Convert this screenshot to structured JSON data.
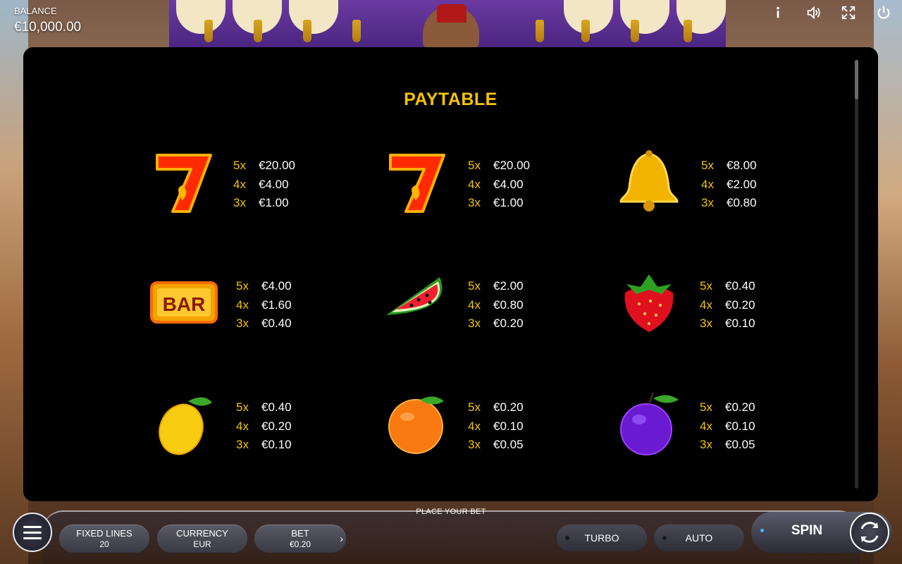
{
  "top_bar": {
    "balance_label": "BALANCE",
    "balance_value": "€10,000.00",
    "icons": [
      "info-icon",
      "sound-icon",
      "fullscreen-icon",
      "power-icon"
    ]
  },
  "paytable": {
    "title": "PAYTABLE",
    "symbols": [
      {
        "name": "red-seven",
        "pays": [
          {
            "mult": "5x",
            "amount": "€20.00"
          },
          {
            "mult": "4x",
            "amount": "€4.00"
          },
          {
            "mult": "3x",
            "amount": "€1.00"
          }
        ]
      },
      {
        "name": "red-seven",
        "pays": [
          {
            "mult": "5x",
            "amount": "€20.00"
          },
          {
            "mult": "4x",
            "amount": "€4.00"
          },
          {
            "mult": "3x",
            "amount": "€1.00"
          }
        ]
      },
      {
        "name": "bell",
        "pays": [
          {
            "mult": "5x",
            "amount": "€8.00"
          },
          {
            "mult": "4x",
            "amount": "€2.00"
          },
          {
            "mult": "3x",
            "amount": "€0.80"
          }
        ]
      },
      {
        "name": "bar",
        "label": "BAR",
        "pays": [
          {
            "mult": "5x",
            "amount": "€4.00"
          },
          {
            "mult": "4x",
            "amount": "€1.60"
          },
          {
            "mult": "3x",
            "amount": "€0.40"
          }
        ]
      },
      {
        "name": "watermelon",
        "pays": [
          {
            "mult": "5x",
            "amount": "€2.00"
          },
          {
            "mult": "4x",
            "amount": "€0.80"
          },
          {
            "mult": "3x",
            "amount": "€0.20"
          }
        ]
      },
      {
        "name": "strawberry",
        "pays": [
          {
            "mult": "5x",
            "amount": "€0.40"
          },
          {
            "mult": "4x",
            "amount": "€0.20"
          },
          {
            "mult": "3x",
            "amount": "€0.10"
          }
        ]
      },
      {
        "name": "lemon",
        "pays": [
          {
            "mult": "5x",
            "amount": "€0.40"
          },
          {
            "mult": "4x",
            "amount": "€0.20"
          },
          {
            "mult": "3x",
            "amount": "€0.10"
          }
        ]
      },
      {
        "name": "orange",
        "pays": [
          {
            "mult": "5x",
            "amount": "€0.20"
          },
          {
            "mult": "4x",
            "amount": "€0.10"
          },
          {
            "mult": "3x",
            "amount": "€0.05"
          }
        ]
      },
      {
        "name": "plum",
        "pays": [
          {
            "mult": "5x",
            "amount": "€0.20"
          },
          {
            "mult": "4x",
            "amount": "€0.10"
          },
          {
            "mult": "3x",
            "amount": "€0.05"
          }
        ]
      }
    ]
  },
  "bottom_bar": {
    "place_bet": "PLACE YOUR BET",
    "fixed_lines_label": "FIXED LINES",
    "fixed_lines_value": "20",
    "currency_label": "CURRENCY",
    "currency_value": "EUR",
    "bet_label": "BET",
    "bet_value": "€0.20",
    "turbo_label": "TURBO",
    "auto_label": "AUTO",
    "spin_label": "SPIN"
  },
  "colors": {
    "accent_gold": "#f5c400",
    "panel_bg": "#000000"
  }
}
